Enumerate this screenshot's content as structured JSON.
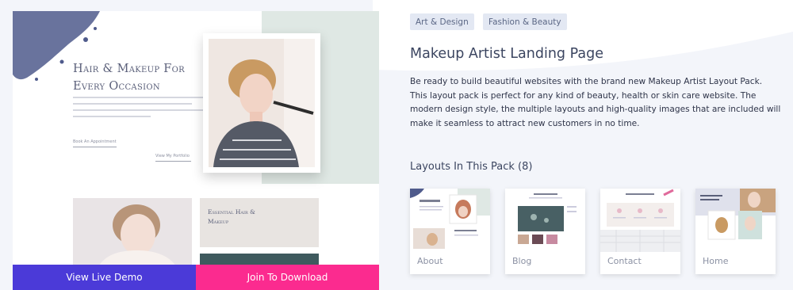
{
  "preview": {
    "hero_title": "Hair & Makeup For Every Occasion",
    "link_primary": "Book An Appointment",
    "link_secondary": "View My Portfolio",
    "thumb_title": "Essential Hair & Makeup"
  },
  "actions": {
    "live_demo_label": "View Live Demo",
    "download_label": "Join To Download"
  },
  "tags": [
    "Art & Design",
    "Fashion & Beauty"
  ],
  "title": "Makeup Artist Landing Page",
  "description": "Be ready to build beautiful websites with the brand new Makeup Artist Layout Pack. This layout pack is perfect for any kind of beauty, health or skin care website. The modern design style, the multiple layouts and high-quality images that are included will make it seamless to attract new customers in no time.",
  "layouts": {
    "heading": "Layouts In This Pack (8)",
    "items": [
      {
        "label": "About"
      },
      {
        "label": "Blog"
      },
      {
        "label": "Contact"
      },
      {
        "label": "Home"
      }
    ]
  },
  "colors": {
    "demo_button": "#4b3ad8",
    "download_button": "#fb2b8f",
    "tag_bg": "#e3e8f3",
    "heading_text": "#3b4560"
  }
}
